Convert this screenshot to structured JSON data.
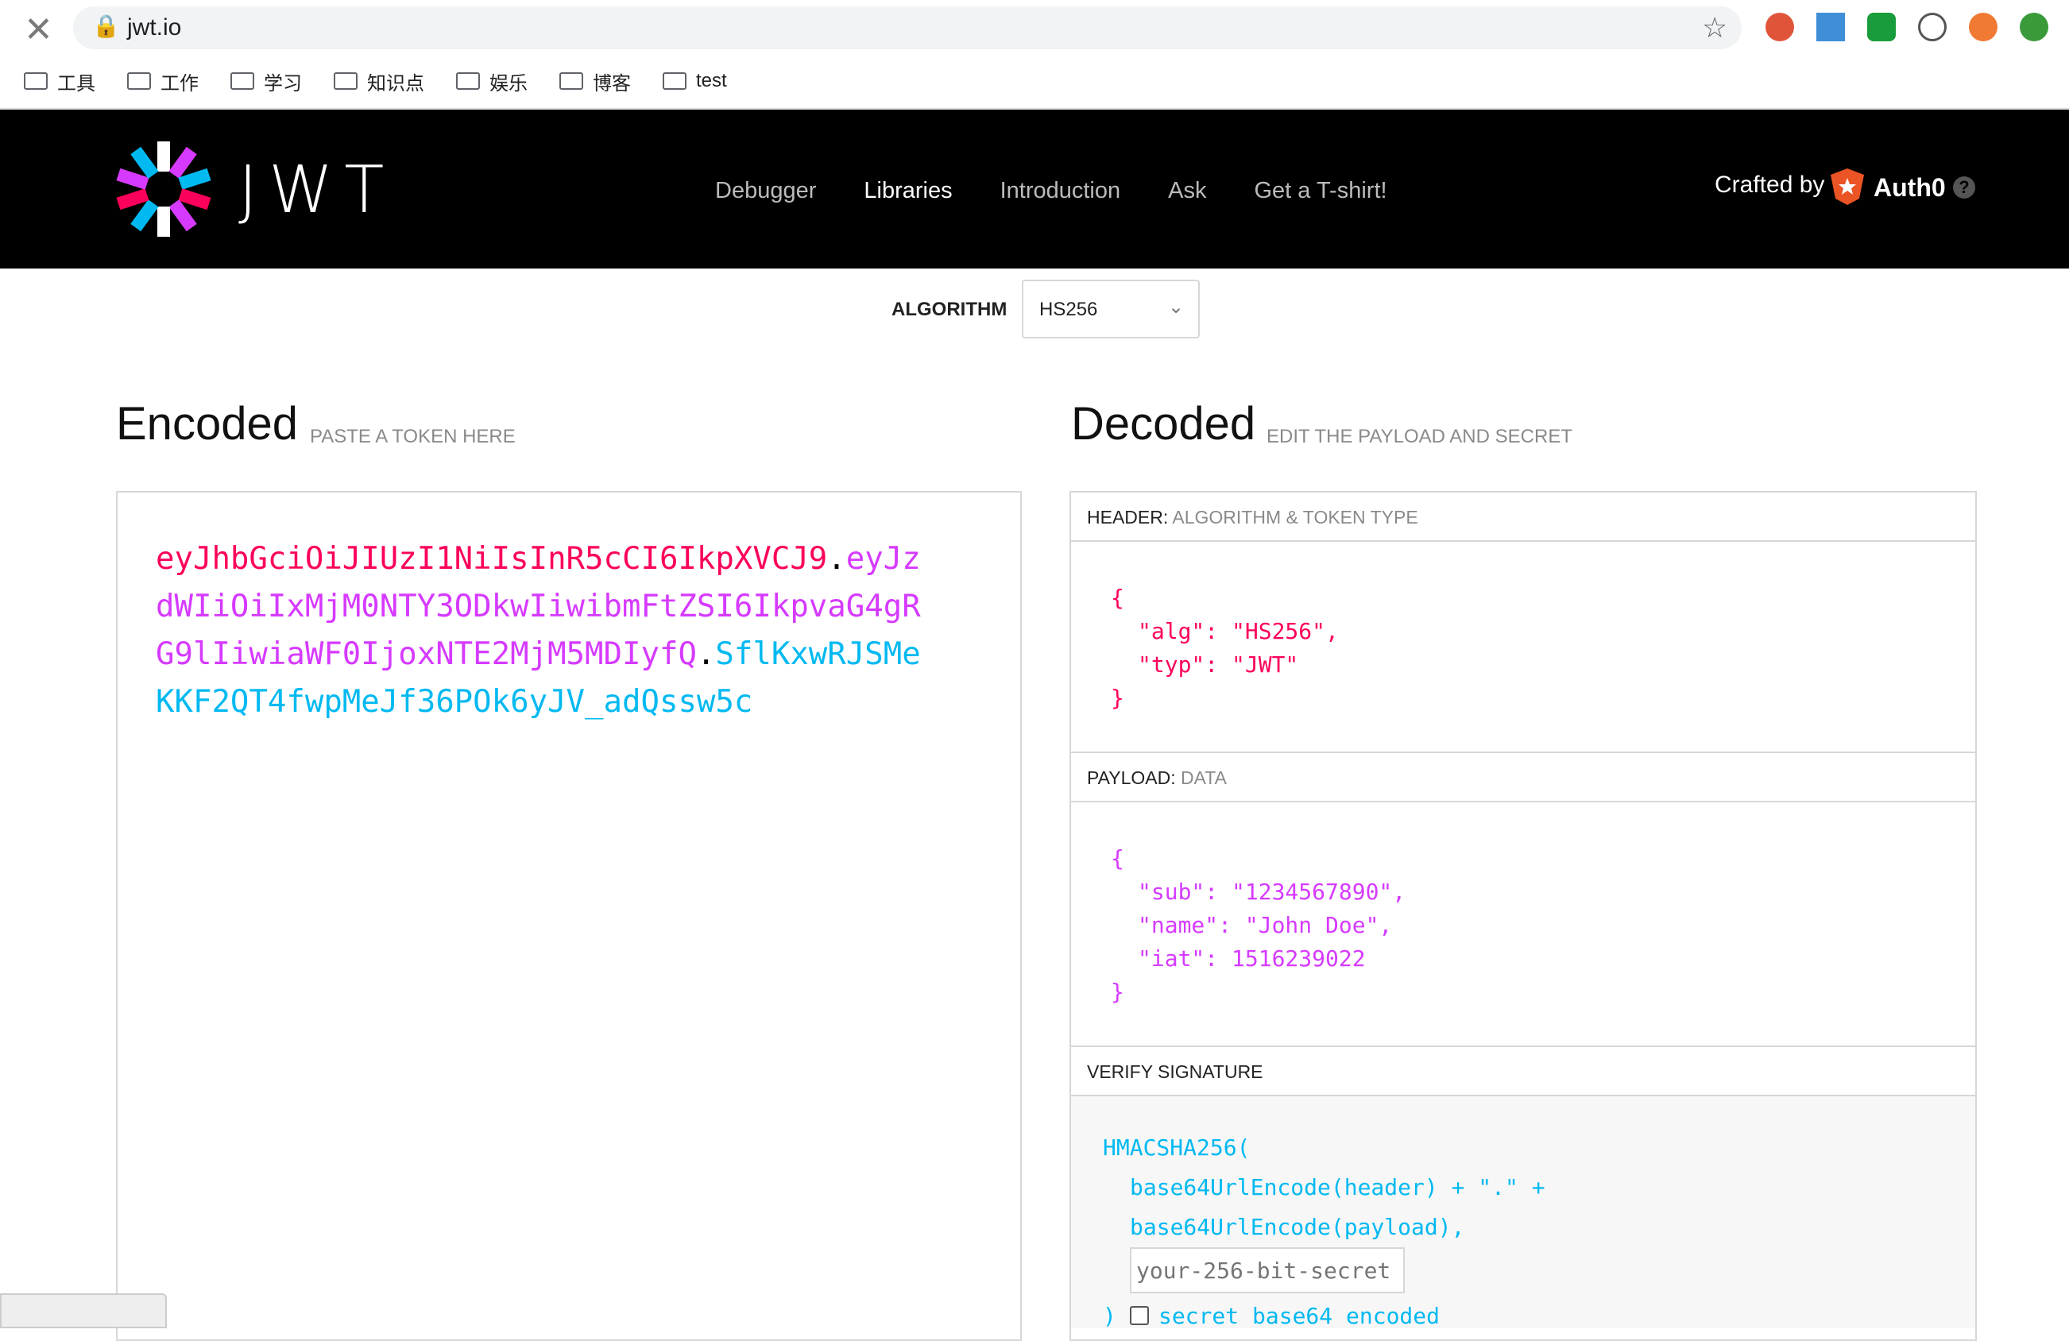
{
  "browser": {
    "url": "jwt.io",
    "bookmarks": [
      "工具",
      "工作",
      "学习",
      "知识点",
      "娱乐",
      "博客",
      "test"
    ]
  },
  "nav": {
    "items": [
      "Debugger",
      "Libraries",
      "Introduction",
      "Ask",
      "Get a T-shirt!"
    ],
    "crafted": "Crafted by",
    "auth0": "Auth0",
    "logo_text": "JWT"
  },
  "algorithm": {
    "label": "ALGORITHM",
    "value": "HS256"
  },
  "encoded": {
    "title": "Encoded",
    "subtitle": "PASTE A TOKEN HERE",
    "token": {
      "header": "eyJhbGciOiJIUzI1NiIsInR5cCI6IkpXVCJ9",
      "payload": "eyJzdWIiOiIxMjM0NTY3ODkwIiwibmFtZSI6IkpvaG4gRG9lIiwiaWF0IjoxNTE2MjM5MDIyfQ",
      "signature": "SflKxwRJSMeKKF2QT4fwpMeJf36POk6yJV_adQssw5c"
    }
  },
  "decoded": {
    "title": "Decoded",
    "subtitle": "EDIT THE PAYLOAD AND SECRET",
    "header_title": "HEADER:",
    "header_sub": "ALGORITHM & TOKEN TYPE",
    "header_json": [
      "{",
      "\"alg\": \"HS256\",",
      "\"typ\": \"JWT\"",
      "}"
    ],
    "payload_title": "PAYLOAD:",
    "payload_sub": "DATA",
    "payload_json": [
      "{",
      "\"sub\": \"1234567890\",",
      "\"name\": \"John Doe\",",
      "\"iat\": 1516239022",
      "}"
    ],
    "verify_title": "VERIFY SIGNATURE",
    "verify_lines": [
      "HMACSHA256(",
      "base64UrlEncode(header) + \".\" +",
      "base64UrlEncode(payload),",
      ")"
    ],
    "secret_placeholder": "your-256-bit-secret",
    "secret_check_label": "secret base64 encoded"
  },
  "colors": {
    "header": "#fb015b",
    "payload": "#d63aff",
    "signature": "#00b9f1"
  }
}
